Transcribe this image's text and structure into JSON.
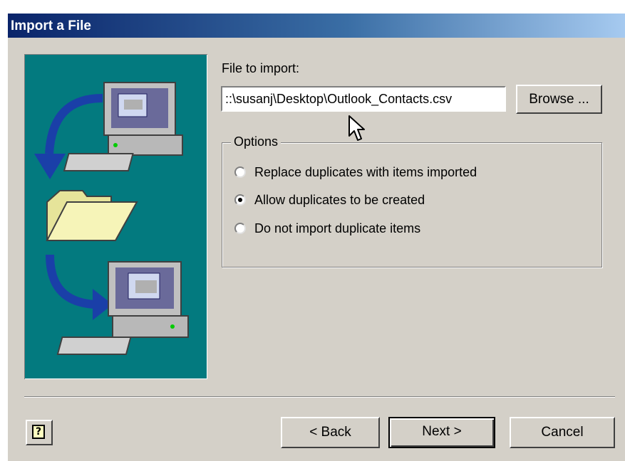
{
  "window": {
    "title": "Import a File"
  },
  "file_section": {
    "label": "File to import:",
    "path_value": "::\\susanj\\Desktop\\Outlook_Contacts.csv",
    "browse_label": "Browse ..."
  },
  "options": {
    "legend": "Options",
    "items": [
      {
        "label": "Replace duplicates with items imported",
        "checked": false
      },
      {
        "label": "Allow duplicates to be created",
        "checked": true
      },
      {
        "label": "Do not import duplicate items",
        "checked": false
      }
    ]
  },
  "footer": {
    "help_glyph": "?",
    "back_label": "< Back",
    "next_label": "Next >",
    "cancel_label": "Cancel"
  },
  "colors": {
    "title_gradient_start": "#0a246a",
    "title_gradient_end": "#a6caf0",
    "art_background": "#037a7f",
    "dialog_face": "#d4d0c8"
  },
  "icons": [
    "computer-icon",
    "folder-icon",
    "arrow-icon",
    "help-icon",
    "mouse-cursor-icon"
  ]
}
